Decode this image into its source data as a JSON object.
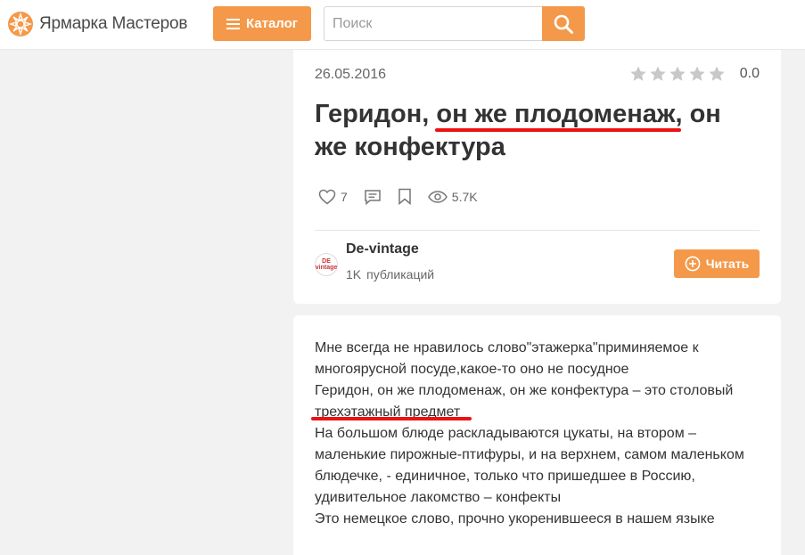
{
  "header": {
    "logo_text": "Ярмарка Мастеров",
    "catalog_label": "Каталог",
    "search_placeholder": "Поиск"
  },
  "post": {
    "date": "26.05.2016",
    "rating": {
      "stars_total": 5,
      "stars_filled": 0,
      "value": "0.0"
    },
    "title": "Геридон, он же плодоменаж, он же конфектура",
    "stats": {
      "likes": "7",
      "views": "5.7K"
    },
    "author": {
      "name": "De-vintage",
      "avatar_text": "DE vintage",
      "pubs_count": "1K",
      "pubs_label": "публикаций"
    },
    "follow_label": "Читать",
    "body_lines": [
      "Мне всегда не нравилось слово\"этажерка\"приминяемое к",
      "многоярусной посуде,какое-то оно не посудное",
      "Геридон, он же плодоменаж, он же конфектура – это столовый",
      "трехэтажный предмет",
      "На большом блюде раскладываются цукаты, на втором –",
      "маленькие пирожные-птифуры, и на верхнем, самом маленьком",
      "блюдечке, - единичное, только что пришедшее в Россию,",
      "удивительное лакомство – конфекты",
      "Это немецкое слово, прочно укоренившееся в нашем языке"
    ]
  },
  "colors": {
    "accent": "#f4994a",
    "annotation_red": "#e11111",
    "star_empty": "#c8c8c8"
  },
  "icons": {
    "logo": "sun-logo-icon",
    "catalog": "menu-icon",
    "search": "search-icon",
    "like": "heart-icon",
    "comments": "comment-icon",
    "bookmark": "bookmark-icon",
    "views": "eye-icon",
    "follow": "plus-circle-icon"
  }
}
